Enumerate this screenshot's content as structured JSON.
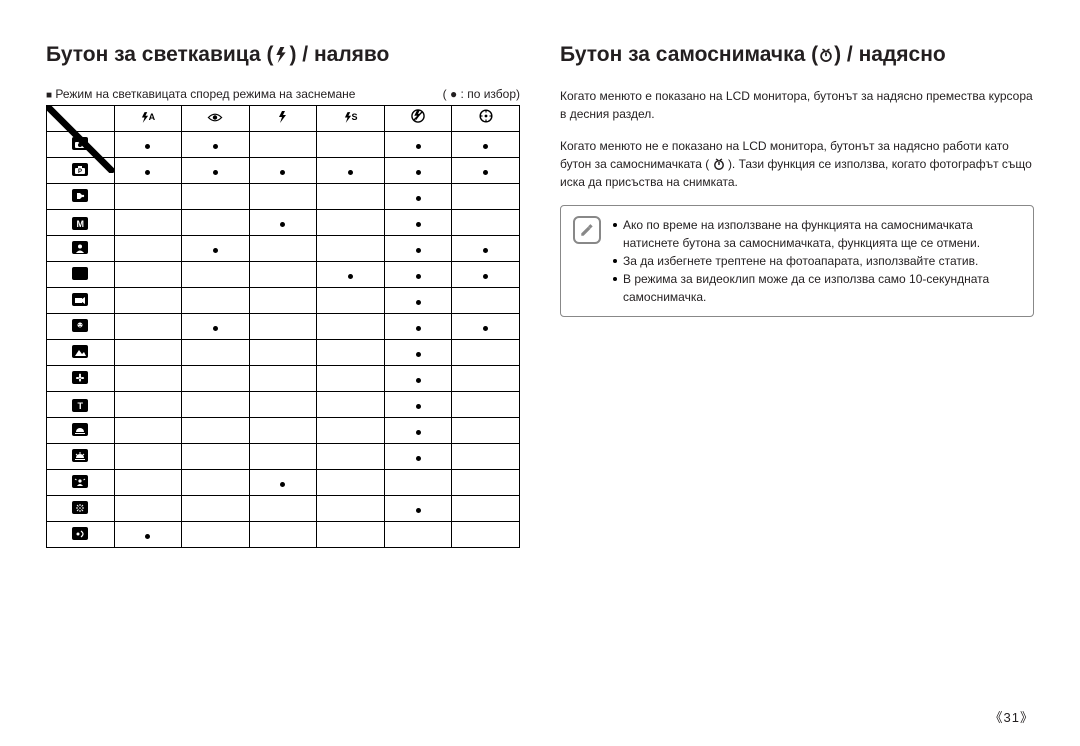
{
  "left": {
    "heading_pre": "Бутон за светкавица (",
    "heading_post": ") / наляво",
    "caption_prefix": "■",
    "caption": "Режим на светкавицата според режима на заснемане",
    "legend": "( ● : по избор)",
    "col_icons": [
      "flash-auto-icon",
      "eye-icon",
      "flash-on-icon",
      "flash-slow-icon",
      "no-flash-icon",
      "aperture-icon"
    ],
    "rows": [
      {
        "icon": "row-camera-icon",
        "cells": [
          1,
          1,
          0,
          0,
          1,
          1
        ]
      },
      {
        "icon": "row-program-icon",
        "cells": [
          1,
          1,
          1,
          1,
          1,
          1
        ]
      },
      {
        "icon": "row-dual-icon",
        "cells": [
          0,
          0,
          0,
          0,
          1,
          0
        ]
      },
      {
        "icon": "row-M-icon",
        "cells": [
          0,
          0,
          1,
          0,
          1,
          0
        ]
      },
      {
        "icon": "row-portrait-icon",
        "cells": [
          0,
          1,
          0,
          0,
          1,
          1
        ]
      },
      {
        "icon": "row-night-icon",
        "cells": [
          0,
          0,
          0,
          1,
          1,
          1
        ]
      },
      {
        "icon": "row-movie-icon",
        "cells": [
          0,
          0,
          0,
          0,
          1,
          0
        ]
      },
      {
        "icon": "row-children-icon",
        "cells": [
          0,
          1,
          0,
          0,
          1,
          1
        ]
      },
      {
        "icon": "row-landscape-icon",
        "cells": [
          0,
          0,
          0,
          0,
          1,
          0
        ]
      },
      {
        "icon": "row-closeup-icon",
        "cells": [
          0,
          0,
          0,
          0,
          1,
          0
        ]
      },
      {
        "icon": "row-text-icon",
        "cells": [
          0,
          0,
          0,
          0,
          1,
          0
        ]
      },
      {
        "icon": "row-sunset-icon",
        "cells": [
          0,
          0,
          0,
          0,
          1,
          0
        ]
      },
      {
        "icon": "row-dawn-icon",
        "cells": [
          0,
          0,
          0,
          0,
          1,
          0
        ]
      },
      {
        "icon": "row-backlight-icon",
        "cells": [
          0,
          0,
          1,
          0,
          0,
          0
        ]
      },
      {
        "icon": "row-firework-icon",
        "cells": [
          0,
          0,
          0,
          0,
          1,
          0
        ]
      },
      {
        "icon": "row-beachsnow-icon",
        "cells": [
          1,
          0,
          0,
          0,
          0,
          0
        ]
      }
    ]
  },
  "right": {
    "heading_pre": "Бутон за самоснимачка (",
    "heading_post": ") / надясно",
    "para1": "Когато менюто е показано на LCD монитора, бутонът за надясно премества курсора в десния раздел.",
    "para2_pre": "Когато менюто не е показано на LCD монитора, бутонът за надясно работи като бутон за самоснимачката (",
    "para2_post": "). Тази функция се използва, когато фотографът също иска да присъства на снимката.",
    "notes": [
      "Ако по време на използване на функцията на самоснимачката натиснете бутона за самоснимачката, функцията ще се отмени.",
      "За да избегнете трептене на фотоапарата, използвайте статив.",
      "В режима за видеоклип може да се използва само 10-секундната самоснимачка."
    ]
  },
  "page_number": "《31》",
  "chart_data": {
    "type": "table",
    "title": "Режим на светкавицата според режима на заснемане",
    "columns": [
      "flash-auto",
      "red-eye",
      "flash-on",
      "flash-slow",
      "flash-off",
      "red-eye-fix"
    ],
    "rows": [
      "auto",
      "program",
      "dual-is",
      "manual",
      "portrait",
      "night",
      "movie",
      "children",
      "landscape",
      "close-up",
      "text",
      "sunset",
      "dawn",
      "backlight",
      "firework",
      "beach-snow"
    ],
    "values": [
      [
        1,
        1,
        0,
        0,
        1,
        1
      ],
      [
        1,
        1,
        1,
        1,
        1,
        1
      ],
      [
        0,
        0,
        0,
        0,
        1,
        0
      ],
      [
        0,
        0,
        1,
        0,
        1,
        0
      ],
      [
        0,
        1,
        0,
        0,
        1,
        1
      ],
      [
        0,
        0,
        0,
        1,
        1,
        1
      ],
      [
        0,
        0,
        0,
        0,
        1,
        0
      ],
      [
        0,
        1,
        0,
        0,
        1,
        1
      ],
      [
        0,
        0,
        0,
        0,
        1,
        0
      ],
      [
        0,
        0,
        0,
        0,
        1,
        0
      ],
      [
        0,
        0,
        0,
        0,
        1,
        0
      ],
      [
        0,
        0,
        0,
        0,
        1,
        0
      ],
      [
        0,
        0,
        0,
        0,
        1,
        0
      ],
      [
        0,
        0,
        1,
        0,
        0,
        0
      ],
      [
        0,
        0,
        0,
        0,
        1,
        0
      ],
      [
        1,
        0,
        0,
        0,
        0,
        0
      ]
    ],
    "legend": "● = по избор (available)"
  }
}
